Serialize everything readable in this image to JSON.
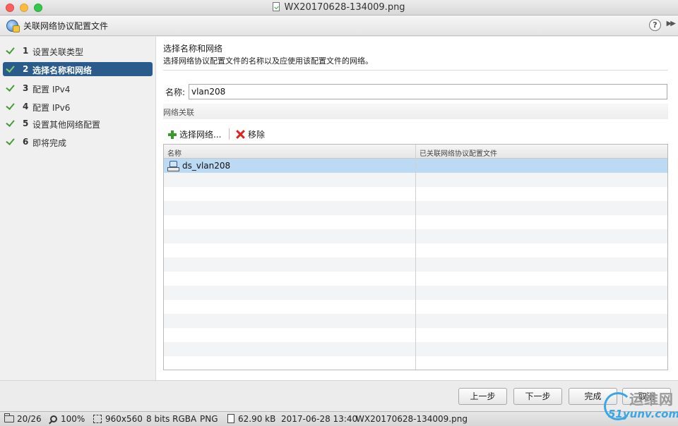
{
  "window": {
    "title": "WX20170628-134009.png"
  },
  "dialog": {
    "title": "关联网络协议配置文件",
    "help_glyph": "?",
    "expand_glyph": "▶▶"
  },
  "steps": [
    {
      "num": "1",
      "label": "设置关联类型",
      "done": true,
      "active": false
    },
    {
      "num": "2",
      "label": "选择名称和网络",
      "done": true,
      "active": true
    },
    {
      "num": "3",
      "label": "配置 IPv4",
      "done": true,
      "active": false
    },
    {
      "num": "4",
      "label": "配置 IPv6",
      "done": true,
      "active": false
    },
    {
      "num": "5",
      "label": "设置其他网络配置",
      "done": true,
      "active": false
    },
    {
      "num": "6",
      "label": "即将完成",
      "done": true,
      "active": false
    }
  ],
  "main": {
    "section_title": "选择名称和网络",
    "section_desc": "选择网络协议配置文件的名称以及应使用该配置文件的网络。",
    "name_label": "名称:",
    "name_value": "vlan208",
    "association_label": "网络关联",
    "toolbar": {
      "select_network": "选择网络...",
      "remove": "移除"
    },
    "table": {
      "columns": [
        "名称",
        "已关联网络协议配置文件"
      ],
      "rows": [
        {
          "name": "ds_vlan208",
          "profile": "",
          "selected": true
        }
      ]
    }
  },
  "footer": {
    "back": "上一步",
    "next": "下一步",
    "finish": "完成",
    "cancel": "取消"
  },
  "statusbar": {
    "index": "20/26",
    "zoom": "100%",
    "dimensions": "960x560",
    "color_depth": "8 bits RGBA",
    "format": "PNG",
    "file_size": "62.90 kB",
    "modified": "2017-06-28 13:40",
    "filename": "WX20170628-134009.png"
  },
  "watermark": {
    "cn": "运维网",
    "en": "51yunv.com"
  },
  "colors": {
    "accent": "#2a5b8a",
    "selection": "#bcdaf4",
    "check": "#4a9a3c"
  }
}
